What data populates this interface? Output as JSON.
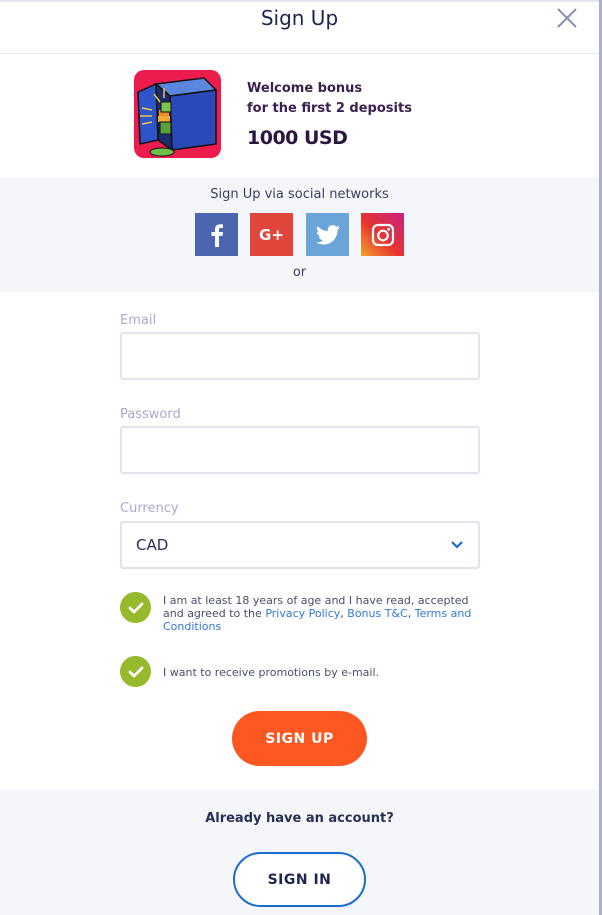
{
  "header": {
    "title": "Sign Up",
    "close_icon": "close-icon"
  },
  "bonus": {
    "line1": "Welcome bonus",
    "line2": "for the first 2 deposits",
    "amount": "1000 USD",
    "image": "safe-with-money-illustration"
  },
  "social": {
    "title": "Sign Up via social networks",
    "buttons": [
      {
        "name": "facebook",
        "icon": "facebook-icon",
        "color": "#4b65ae"
      },
      {
        "name": "google-plus",
        "icon": "google-plus-icon",
        "color": "#e0463c"
      },
      {
        "name": "twitter",
        "icon": "twitter-icon",
        "color": "#6ba4d9"
      },
      {
        "name": "instagram",
        "icon": "instagram-icon",
        "color": "#e7342f"
      }
    ],
    "or": "or"
  },
  "form": {
    "email": {
      "label": "Email",
      "value": "",
      "placeholder": ""
    },
    "password": {
      "label": "Password",
      "value": "",
      "placeholder": ""
    },
    "currency": {
      "label": "Currency",
      "value": "CAD"
    },
    "terms": {
      "checked": true,
      "text": "I am at least 18 years of age and I have read, accepted and agreed to the ",
      "links": [
        "Privacy Policy",
        "Bonus T&C",
        "Terms and Conditions"
      ],
      "sep": ", "
    },
    "promotions": {
      "checked": true,
      "text": "I want to receive promotions by e-mail."
    },
    "submit": "SIGN UP"
  },
  "footer": {
    "question": "Already have an account?",
    "signin": "SIGN IN"
  },
  "colors": {
    "accent": "#ff5722",
    "check": "#96b92d",
    "link": "#2f7ad6",
    "signin_border": "#1a6dd0"
  }
}
